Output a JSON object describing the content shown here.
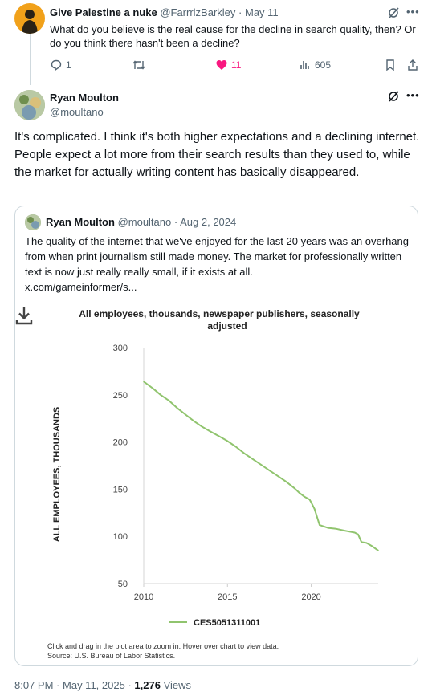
{
  "reply": {
    "name": "Give Palestine a nuke",
    "handle": "@FarrrlzBarkley",
    "date": "May 11",
    "text": "What do you believe is the real cause for the decline in search quality, then? Or do you think there hasn't been a decline?",
    "stats": {
      "replies": "1",
      "likes": "11",
      "views": "605"
    }
  },
  "tweet": {
    "name": "Ryan Moulton",
    "handle": "@moultano",
    "text": "It's complicated. I think it's both higher expectations and a declining internet. People expect a lot more from their search results than they used to, while the market for actually writing content has basically disappeared.",
    "time": "8:07 PM",
    "date": "May 11, 2025",
    "views_count": "1,276",
    "views_label": "Views"
  },
  "quote": {
    "name": "Ryan Moulton",
    "handle": "@moultano",
    "date": "Aug 2, 2024",
    "text": "The quality of the internet that we've enjoyed for the last 20 years was an overhang from when print journalism still made money. The market for professionally written text is now just really really small, if it exists at all.",
    "link": "x.com/gameinformer/s..."
  },
  "chart_data": {
    "type": "line",
    "title": "All employees, thousands, newspaper publishers, seasonally adjusted",
    "ylabel": "ALL EMPLOYEES, THOUSANDS",
    "xlabel": "",
    "xlim": [
      2010,
      2024
    ],
    "ylim": [
      50,
      300
    ],
    "yticks": [
      300,
      250,
      200,
      150,
      100,
      50
    ],
    "xticks": [
      2010,
      2015,
      2020
    ],
    "line_color": "#90c46e",
    "series": [
      {
        "name": "CES5051311001",
        "x": [
          2010,
          2010.3,
          2010.6,
          2011,
          2011.5,
          2012,
          2012.5,
          2013,
          2013.5,
          2014,
          2014.5,
          2015,
          2015.5,
          2016,
          2016.5,
          2017,
          2017.5,
          2018,
          2018.5,
          2019,
          2019.3,
          2019.6,
          2019.9,
          2020,
          2020.2,
          2020.5,
          2021,
          2021.5,
          2022,
          2022.3,
          2022.6,
          2022.8,
          2023,
          2023.3,
          2023.6,
          2024
        ],
        "y": [
          264,
          260,
          256,
          250,
          244,
          236,
          229,
          222,
          216,
          211,
          206,
          201,
          195,
          188,
          182,
          176,
          170,
          164,
          158,
          151,
          146,
          142,
          139,
          136,
          129,
          112,
          109,
          108,
          106,
          105,
          104,
          102,
          94,
          93,
          90,
          85
        ]
      }
    ],
    "caption_1": "Click and drag in the plot area to zoom in. Hover over chart to view data.",
    "caption_2": "Source: U.S. Bureau of Labor Statistics."
  },
  "colors": {
    "like": "#f91880",
    "secondary": "#536471",
    "border": "#cfd9de"
  },
  "icons": [
    "grok-icon",
    "more-icon",
    "reply-icon",
    "retweet-icon",
    "heart-icon",
    "views-icon",
    "bookmark-icon",
    "share-icon",
    "download-icon"
  ]
}
